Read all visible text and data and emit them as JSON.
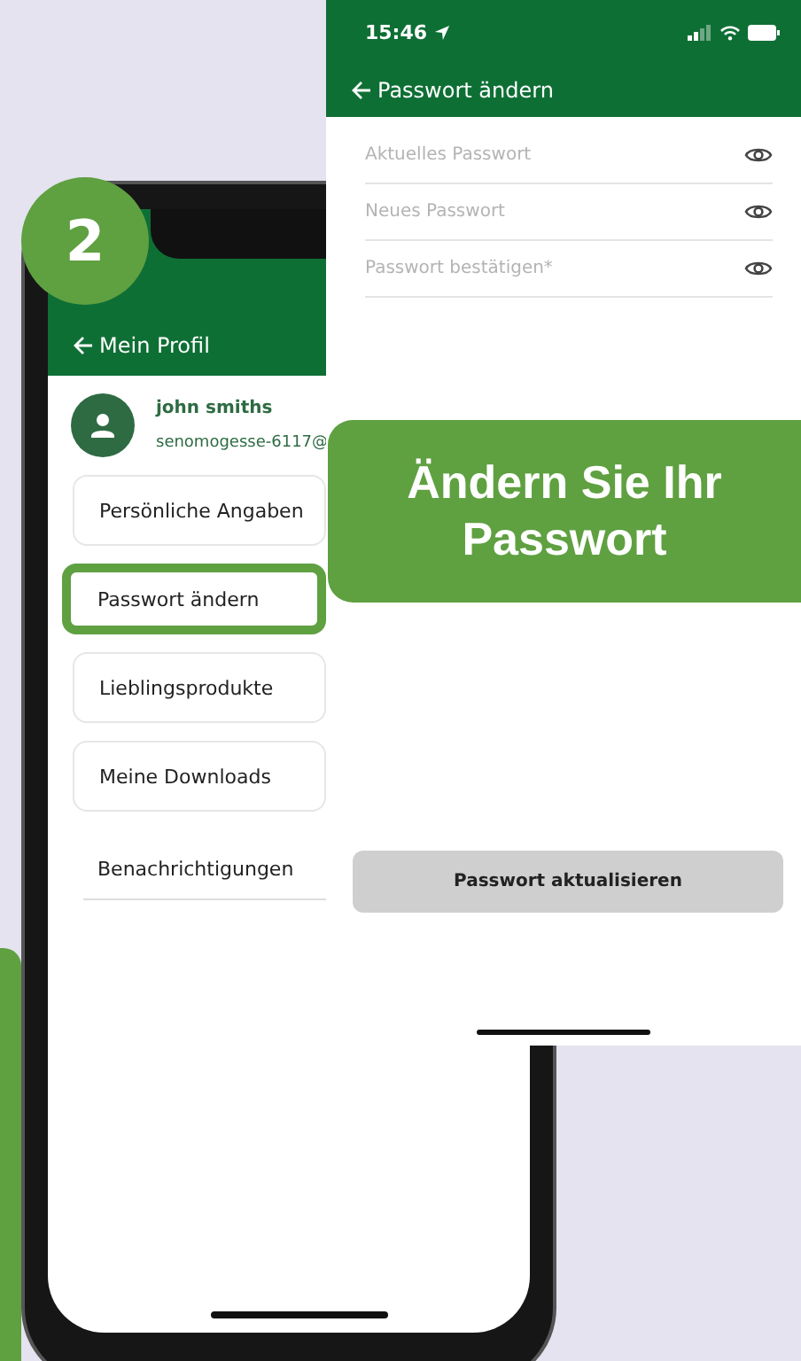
{
  "badge": {
    "label": "2"
  },
  "profile_screen": {
    "title": "Mein Profil",
    "user": {
      "name": "john smiths",
      "email": "senomogesse-6117@"
    },
    "menu": [
      {
        "label": "Persönliche Angaben",
        "kind": "card",
        "selected": false
      },
      {
        "label": "Passwort ändern",
        "kind": "card",
        "selected": true
      },
      {
        "label": "Lieblingsprodukte",
        "kind": "card",
        "selected": false
      },
      {
        "label": "Meine Downloads",
        "kind": "card",
        "selected": false
      },
      {
        "label": "Benachrichtigungen",
        "kind": "plain",
        "selected": false
      }
    ]
  },
  "password_screen": {
    "status_bar": {
      "time": "15:46"
    },
    "title": "Passwort ändern",
    "fields": [
      {
        "placeholder": "Aktuelles Passwort"
      },
      {
        "placeholder": "Neues Passwort"
      },
      {
        "placeholder": "Passwort bestätigen*"
      }
    ],
    "button": {
      "label": "Passwort aktualisieren"
    }
  },
  "callout": {
    "text": "Ändern Sie Ihr Passwort"
  }
}
